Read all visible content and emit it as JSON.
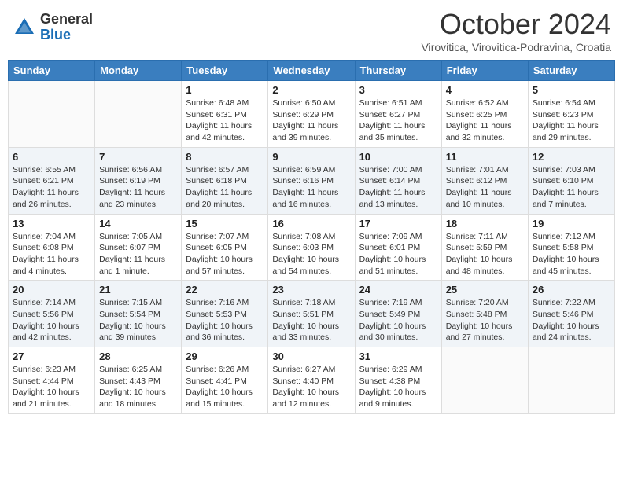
{
  "header": {
    "logo_general": "General",
    "logo_blue": "Blue",
    "month_title": "October 2024",
    "subtitle": "Virovitica, Virovitica-Podravina, Croatia"
  },
  "weekdays": [
    "Sunday",
    "Monday",
    "Tuesday",
    "Wednesday",
    "Thursday",
    "Friday",
    "Saturday"
  ],
  "weeks": [
    [
      {
        "day": "",
        "info": ""
      },
      {
        "day": "",
        "info": ""
      },
      {
        "day": "1",
        "info": "Sunrise: 6:48 AM\nSunset: 6:31 PM\nDaylight: 11 hours and 42 minutes."
      },
      {
        "day": "2",
        "info": "Sunrise: 6:50 AM\nSunset: 6:29 PM\nDaylight: 11 hours and 39 minutes."
      },
      {
        "day": "3",
        "info": "Sunrise: 6:51 AM\nSunset: 6:27 PM\nDaylight: 11 hours and 35 minutes."
      },
      {
        "day": "4",
        "info": "Sunrise: 6:52 AM\nSunset: 6:25 PM\nDaylight: 11 hours and 32 minutes."
      },
      {
        "day": "5",
        "info": "Sunrise: 6:54 AM\nSunset: 6:23 PM\nDaylight: 11 hours and 29 minutes."
      }
    ],
    [
      {
        "day": "6",
        "info": "Sunrise: 6:55 AM\nSunset: 6:21 PM\nDaylight: 11 hours and 26 minutes."
      },
      {
        "day": "7",
        "info": "Sunrise: 6:56 AM\nSunset: 6:19 PM\nDaylight: 11 hours and 23 minutes."
      },
      {
        "day": "8",
        "info": "Sunrise: 6:57 AM\nSunset: 6:18 PM\nDaylight: 11 hours and 20 minutes."
      },
      {
        "day": "9",
        "info": "Sunrise: 6:59 AM\nSunset: 6:16 PM\nDaylight: 11 hours and 16 minutes."
      },
      {
        "day": "10",
        "info": "Sunrise: 7:00 AM\nSunset: 6:14 PM\nDaylight: 11 hours and 13 minutes."
      },
      {
        "day": "11",
        "info": "Sunrise: 7:01 AM\nSunset: 6:12 PM\nDaylight: 11 hours and 10 minutes."
      },
      {
        "day": "12",
        "info": "Sunrise: 7:03 AM\nSunset: 6:10 PM\nDaylight: 11 hours and 7 minutes."
      }
    ],
    [
      {
        "day": "13",
        "info": "Sunrise: 7:04 AM\nSunset: 6:08 PM\nDaylight: 11 hours and 4 minutes."
      },
      {
        "day": "14",
        "info": "Sunrise: 7:05 AM\nSunset: 6:07 PM\nDaylight: 11 hours and 1 minute."
      },
      {
        "day": "15",
        "info": "Sunrise: 7:07 AM\nSunset: 6:05 PM\nDaylight: 10 hours and 57 minutes."
      },
      {
        "day": "16",
        "info": "Sunrise: 7:08 AM\nSunset: 6:03 PM\nDaylight: 10 hours and 54 minutes."
      },
      {
        "day": "17",
        "info": "Sunrise: 7:09 AM\nSunset: 6:01 PM\nDaylight: 10 hours and 51 minutes."
      },
      {
        "day": "18",
        "info": "Sunrise: 7:11 AM\nSunset: 5:59 PM\nDaylight: 10 hours and 48 minutes."
      },
      {
        "day": "19",
        "info": "Sunrise: 7:12 AM\nSunset: 5:58 PM\nDaylight: 10 hours and 45 minutes."
      }
    ],
    [
      {
        "day": "20",
        "info": "Sunrise: 7:14 AM\nSunset: 5:56 PM\nDaylight: 10 hours and 42 minutes."
      },
      {
        "day": "21",
        "info": "Sunrise: 7:15 AM\nSunset: 5:54 PM\nDaylight: 10 hours and 39 minutes."
      },
      {
        "day": "22",
        "info": "Sunrise: 7:16 AM\nSunset: 5:53 PM\nDaylight: 10 hours and 36 minutes."
      },
      {
        "day": "23",
        "info": "Sunrise: 7:18 AM\nSunset: 5:51 PM\nDaylight: 10 hours and 33 minutes."
      },
      {
        "day": "24",
        "info": "Sunrise: 7:19 AM\nSunset: 5:49 PM\nDaylight: 10 hours and 30 minutes."
      },
      {
        "day": "25",
        "info": "Sunrise: 7:20 AM\nSunset: 5:48 PM\nDaylight: 10 hours and 27 minutes."
      },
      {
        "day": "26",
        "info": "Sunrise: 7:22 AM\nSunset: 5:46 PM\nDaylight: 10 hours and 24 minutes."
      }
    ],
    [
      {
        "day": "27",
        "info": "Sunrise: 6:23 AM\nSunset: 4:44 PM\nDaylight: 10 hours and 21 minutes."
      },
      {
        "day": "28",
        "info": "Sunrise: 6:25 AM\nSunset: 4:43 PM\nDaylight: 10 hours and 18 minutes."
      },
      {
        "day": "29",
        "info": "Sunrise: 6:26 AM\nSunset: 4:41 PM\nDaylight: 10 hours and 15 minutes."
      },
      {
        "day": "30",
        "info": "Sunrise: 6:27 AM\nSunset: 4:40 PM\nDaylight: 10 hours and 12 minutes."
      },
      {
        "day": "31",
        "info": "Sunrise: 6:29 AM\nSunset: 4:38 PM\nDaylight: 10 hours and 9 minutes."
      },
      {
        "day": "",
        "info": ""
      },
      {
        "day": "",
        "info": ""
      }
    ]
  ]
}
